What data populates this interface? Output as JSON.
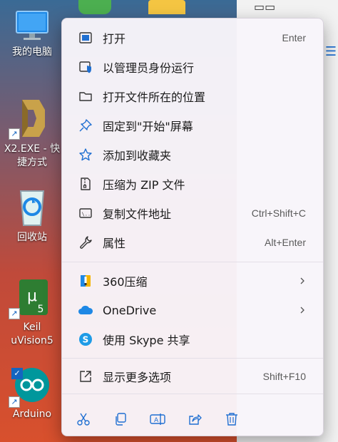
{
  "desktop": {
    "icons": [
      {
        "label": "我的电脑",
        "icon": "monitor-icon"
      },
      {
        "label": "X2.EXE - 快捷方式",
        "label_line1": "X2.EXE - 快",
        "label_line2": "捷方式",
        "icon": "x2-app-icon"
      },
      {
        "label": "回收站",
        "icon": "recycle-bin-icon"
      },
      {
        "label": "Keil uVision5",
        "label_line1": "Keil",
        "label_line2": "uVision5",
        "icon": "keil-icon"
      },
      {
        "label": "Arduino",
        "icon": "arduino-icon"
      }
    ]
  },
  "menu": {
    "items": [
      {
        "label": "打开",
        "shortcut": "Enter",
        "icon": "open-window-icon"
      },
      {
        "label": "以管理员身份运行",
        "shortcut": "",
        "icon": "admin-shield-icon"
      },
      {
        "label": "打开文件所在的位置",
        "shortcut": "",
        "icon": "folder-icon"
      },
      {
        "label": "固定到\"开始\"屏幕",
        "shortcut": "",
        "icon": "pin-icon"
      },
      {
        "label": "添加到收藏夹",
        "shortcut": "",
        "icon": "star-icon"
      },
      {
        "label": "压缩为 ZIP 文件",
        "shortcut": "",
        "icon": "zip-icon"
      },
      {
        "label": "复制文件地址",
        "shortcut": "Ctrl+Shift+C",
        "icon": "copy-path-icon"
      },
      {
        "label": "属性",
        "shortcut": "Alt+Enter",
        "icon": "wrench-icon"
      },
      {
        "label": "360压缩",
        "shortcut": "",
        "icon": "360-zip-icon"
      },
      {
        "label": "OneDrive",
        "shortcut": "",
        "icon": "onedrive-icon"
      },
      {
        "label": "使用 Skype 共享",
        "shortcut": "",
        "icon": "skype-icon"
      },
      {
        "label": "显示更多选项",
        "shortcut": "Shift+F10",
        "icon": "more-options-icon"
      }
    ],
    "bottom_bar": [
      {
        "name": "cut",
        "icon": "cut-icon"
      },
      {
        "name": "copy",
        "icon": "copy-icon"
      },
      {
        "name": "rename",
        "icon": "rename-icon"
      },
      {
        "name": "share",
        "icon": "share-icon"
      },
      {
        "name": "delete",
        "icon": "delete-icon"
      }
    ]
  },
  "colors": {
    "accent": "#1f6fd1",
    "menu_bg": "#f8f5fa",
    "text": "#1a1a1a",
    "shortcut_text": "#5a5a5a"
  }
}
